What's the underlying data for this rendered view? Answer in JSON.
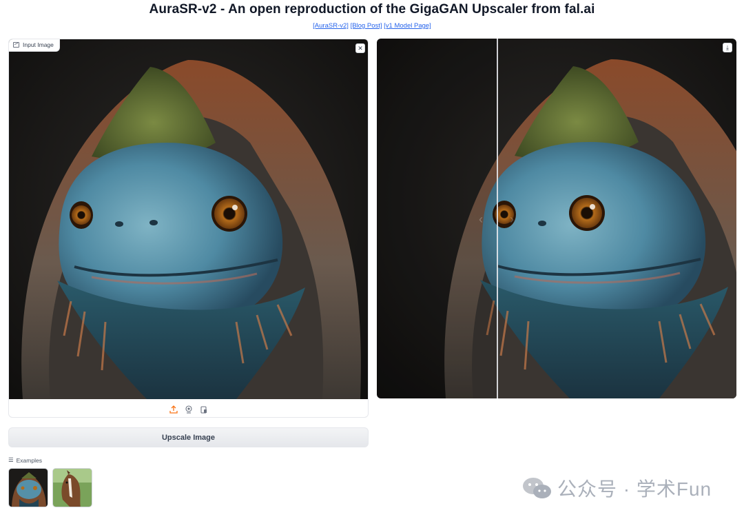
{
  "header": {
    "title": "AuraSR-v2 - An open reproduction of the GigaGAN Upscaler from fal.ai",
    "links": [
      "[AuraSR-v2]",
      "[Blog Post]",
      "[v1 Model Page]"
    ]
  },
  "input_panel": {
    "label": "Input Image",
    "clear_icon": "close-icon",
    "tools": [
      "upload-icon",
      "webcam-icon",
      "clipboard-icon"
    ]
  },
  "output_panel": {
    "download_icon": "download-icon",
    "slider_position": 0.33
  },
  "upscale_button": {
    "label": "Upscale Image"
  },
  "examples": {
    "label": "Examples",
    "items": [
      "lizard-thumbnail",
      "horse-thumbnail"
    ]
  },
  "watermark": {
    "text": "公众号 · 学术Fun"
  },
  "colors": {
    "link": "#2563eb",
    "accent_orange": "#f97316"
  }
}
